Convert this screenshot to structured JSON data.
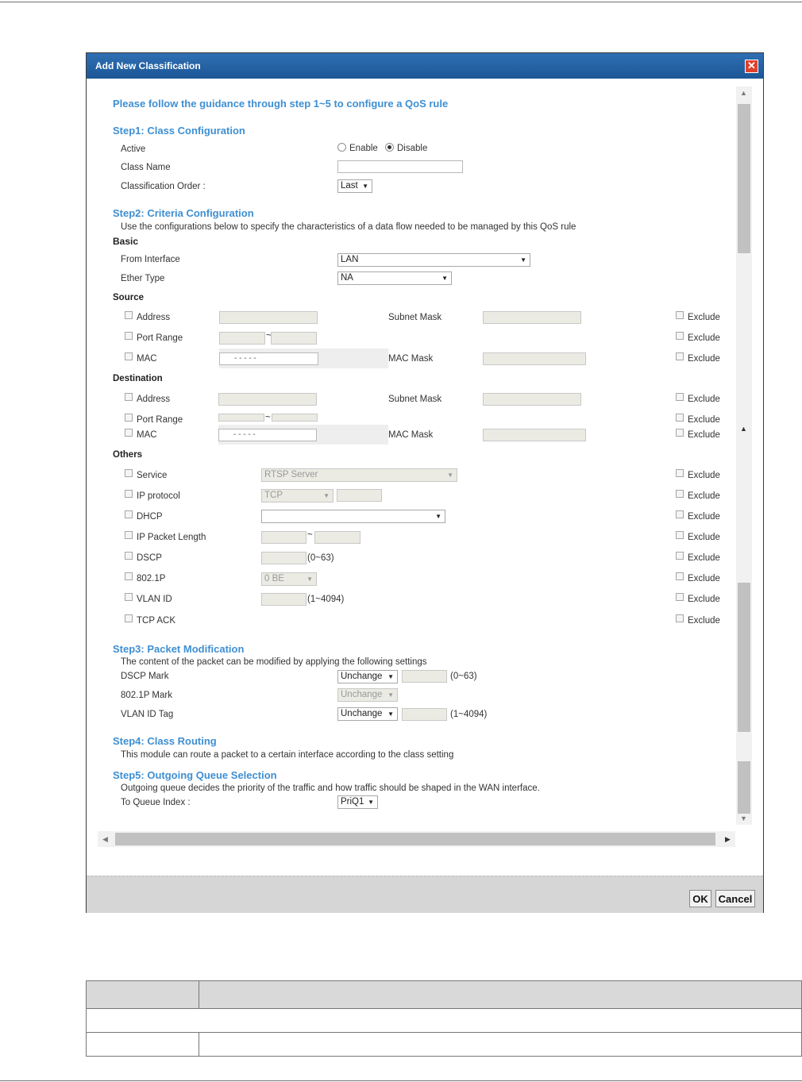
{
  "dialog": {
    "title": "Add New Classification",
    "guide": "Please follow the guidance through step 1~5 to configure a QoS rule",
    "ok_label": "OK",
    "cancel_label": "Cancel"
  },
  "step1": {
    "title": "Step1: Class Configuration",
    "active_label": "Active",
    "enable_label": "Enable",
    "disable_label": "Disable",
    "active_value": "Disable",
    "class_name_label": "Class Name",
    "class_name_value": "",
    "order_label": "Classification Order :",
    "order_value": "Last"
  },
  "step2": {
    "title": "Step2: Criteria Configuration",
    "desc": "Use the configurations below to specify the characteristics of a data flow needed to be managed by this QoS rule",
    "basic_label": "Basic",
    "from_interface_label": "From Interface",
    "from_interface_value": "LAN",
    "ether_type_label": "Ether Type",
    "ether_type_value": "NA",
    "source_label": "Source",
    "destination_label": "Destination",
    "others_label": "Others",
    "address_label": "Address",
    "port_range_label": "Port Range",
    "mac_label": "MAC",
    "subnet_mask_label": "Subnet Mask",
    "mac_mask_label": "MAC Mask",
    "exclude_label": "Exclude",
    "mac_placeholder": "-    -    -    -    -",
    "tilde": "~",
    "service_label": "Service",
    "service_value": "RTSP Server",
    "ip_protocol_label": "IP protocol",
    "ip_protocol_value": "TCP",
    "dhcp_label": "DHCP",
    "dhcp_value": "",
    "ip_packet_length_label": "IP Packet Length",
    "dscp_label": "DSCP",
    "dscp_range": "(0~63)",
    "dot1p_label": "802.1P",
    "dot1p_value": "0 BE",
    "vlan_id_label": "VLAN ID",
    "vlan_range": "(1~4094)",
    "tcp_ack_label": "TCP ACK"
  },
  "step3": {
    "title": "Step3: Packet Modification",
    "desc": "The content of the packet can be modified by applying the following settings",
    "dscp_mark_label": "DSCP Mark",
    "dscp_mark_value": "Unchange",
    "dscp_range": "(0~63)",
    "dot1p_mark_label": "802.1P Mark",
    "dot1p_mark_value": "Unchange",
    "vlan_tag_label": "VLAN ID Tag",
    "vlan_tag_value": "Unchange",
    "vlan_range": "(1~4094)"
  },
  "step4": {
    "title": "Step4: Class Routing",
    "desc": "This module can route a packet to a certain interface according to the class setting"
  },
  "step5": {
    "title": "Step5: Outgoing Queue Selection",
    "desc": "Outgoing queue decides the priority of the traffic and how traffic should be shaped in the WAN interface.",
    "queue_label": "To Queue Index :",
    "queue_value": "PriQ1"
  },
  "colors": {
    "title_bar": "#1c5797",
    "step_heading": "#3f8fd2",
    "close_button": "#e0412c"
  }
}
